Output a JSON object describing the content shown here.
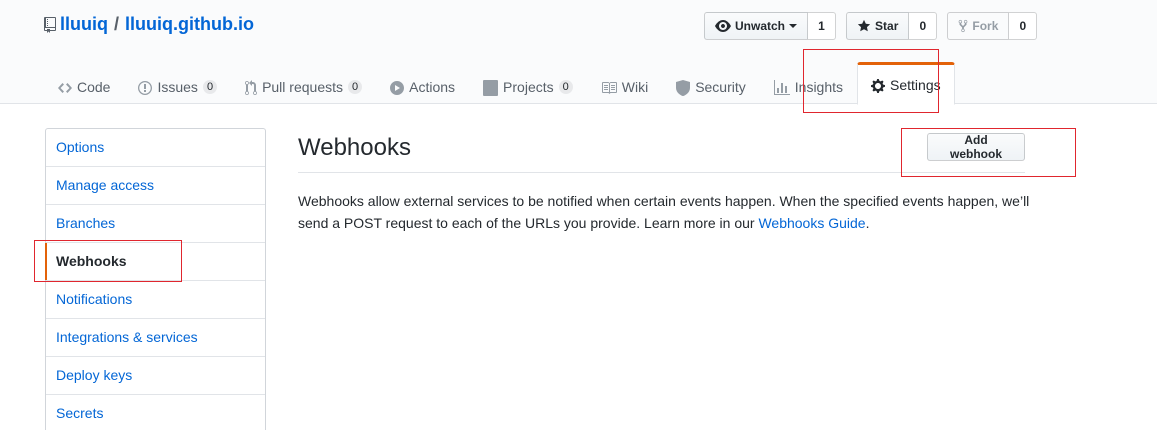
{
  "repo": {
    "owner": "lluuiq",
    "separator": "/",
    "name": "lluuiq.github.io"
  },
  "actions": {
    "watch": {
      "label": "Unwatch",
      "count": "1"
    },
    "star": {
      "label": "Star",
      "count": "0"
    },
    "fork": {
      "label": "Fork",
      "count": "0"
    }
  },
  "nav": {
    "code": {
      "label": "Code"
    },
    "issues": {
      "label": "Issues",
      "count": "0"
    },
    "pulls": {
      "label": "Pull requests",
      "count": "0"
    },
    "actions": {
      "label": "Actions"
    },
    "projects": {
      "label": "Projects",
      "count": "0"
    },
    "wiki": {
      "label": "Wiki"
    },
    "security": {
      "label": "Security"
    },
    "insights": {
      "label": "Insights"
    },
    "settings": {
      "label": "Settings"
    }
  },
  "sidebar": {
    "items": [
      {
        "label": "Options"
      },
      {
        "label": "Manage access"
      },
      {
        "label": "Branches"
      },
      {
        "label": "Webhooks"
      },
      {
        "label": "Notifications"
      },
      {
        "label": "Integrations & services"
      },
      {
        "label": "Deploy keys"
      },
      {
        "label": "Secrets"
      }
    ],
    "selected_index": 3
  },
  "main": {
    "heading": "Webhooks",
    "add_button": "Add webhook",
    "description": "Webhooks allow external services to be notified when certain events happen. When the specified events happen, we’ll send a POST request to each of the URLs you provide. Learn more in our",
    "guide_link": "Webhooks Guide",
    "description_end": "."
  },
  "colors": {
    "accent": "#e36209",
    "link": "#0366d6",
    "annotation": "#e0262e"
  }
}
